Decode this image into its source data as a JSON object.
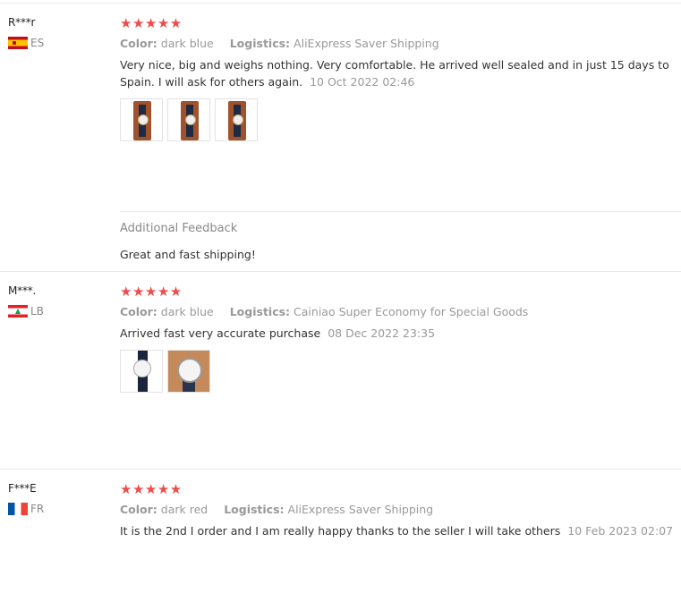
{
  "reviews": [
    {
      "user": "R***r",
      "country": "ES",
      "stars": "★★★★★",
      "color_label": "Color:",
      "color_value": "dark blue",
      "logistics_label": "Logistics:",
      "logistics_value": "AliExpress Saver Shipping",
      "text": "Very nice, big and weighs nothing. Very comfortable. He arrived well sealed and in just 15 days to Spain. I will ask for others again.",
      "date": "10 Oct 2022 02:46",
      "photos": 3,
      "additional_title": "Additional Feedback",
      "additional_text": "Great and fast shipping!"
    },
    {
      "user": "M***.",
      "country": "LB",
      "stars": "★★★★★",
      "color_label": "Color:",
      "color_value": "dark blue",
      "logistics_label": "Logistics:",
      "logistics_value": "Cainiao Super Economy for Special Goods",
      "text": "Arrived fast very accurate purchase",
      "date": "08 Dec 2022 23:35",
      "photos": 2
    },
    {
      "user": "F***E",
      "country": "FR",
      "stars": "★★★★★",
      "color_label": "Color:",
      "color_value": "dark red",
      "logistics_label": "Logistics:",
      "logistics_value": "AliExpress Saver Shipping",
      "text": "It is the 2nd I order and I am really happy thanks to the seller I will take others",
      "date": "10 Feb 2023 02:07",
      "photos": 0
    }
  ],
  "colors": {
    "star": "#f04b4b",
    "muted": "#999999",
    "divider": "#e8e8e8"
  },
  "rating": {
    "max": 5,
    "values": [
      5,
      5,
      5
    ]
  }
}
